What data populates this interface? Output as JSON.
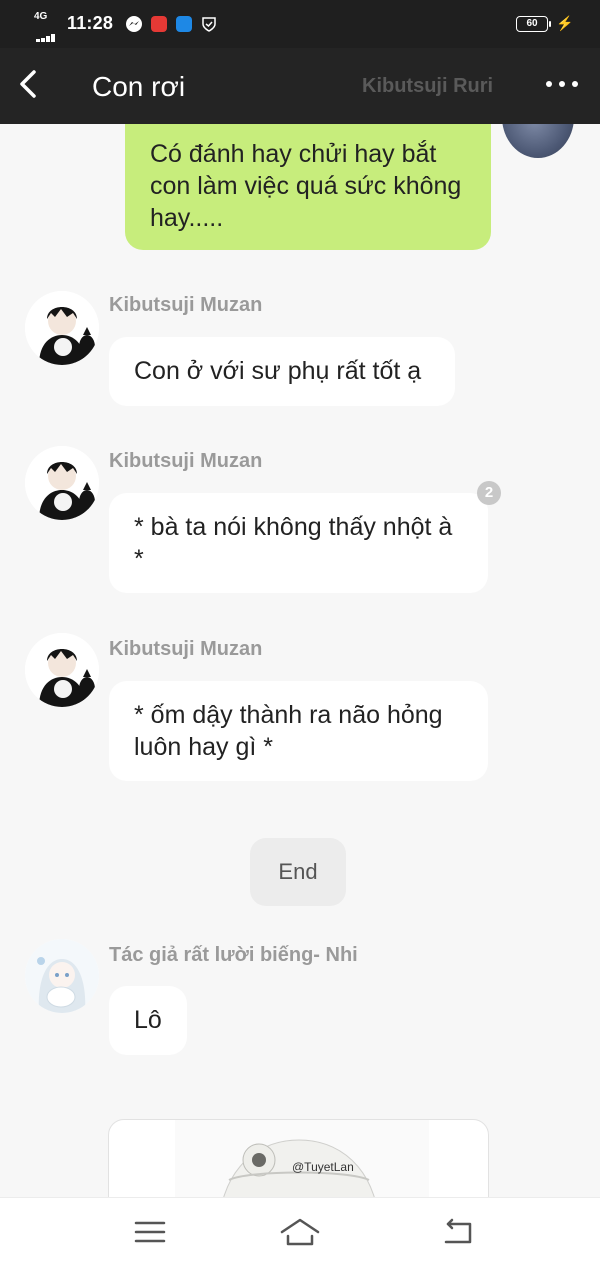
{
  "status_bar": {
    "network": "4G",
    "time": "11:28",
    "battery": "60",
    "colors": {
      "messenger": "#1e88e5",
      "app_red": "#e53935",
      "app_blue": "#1e88e5"
    }
  },
  "header": {
    "title": "Con rơi",
    "ghost_name": "Kibutsuji Ruri"
  },
  "messages": [
    {
      "side": "right",
      "text": "Có đánh hay chửi hay bắt con làm việc quá sức không hay....."
    },
    {
      "side": "left",
      "sender": "Kibutsuji Muzan",
      "text": "Con ở với sư phụ rất tốt ạ"
    },
    {
      "side": "left",
      "sender": "Kibutsuji Muzan",
      "text": "* bà ta nói không thấy nhột à *",
      "badge": "2"
    },
    {
      "side": "left",
      "sender": "Kibutsuji Muzan",
      "text": "* ốm dậy thành ra não hỏng luôn hay gì *"
    },
    {
      "type": "chip",
      "text": "End"
    },
    {
      "side": "left",
      "sender": "Tác giả rất lười biếng- Nhi",
      "text": "Lô"
    },
    {
      "side": "left",
      "type": "image",
      "watermark": "@TuyetLan"
    }
  ],
  "nav": {
    "icons": [
      "menu-icon",
      "home-icon",
      "back-icon"
    ]
  },
  "colors": {
    "header_bg": "#242424",
    "my_bubble": "#c7ed7c",
    "their_bubble": "#ffffff",
    "chat_bg": "#f7f7f7"
  }
}
